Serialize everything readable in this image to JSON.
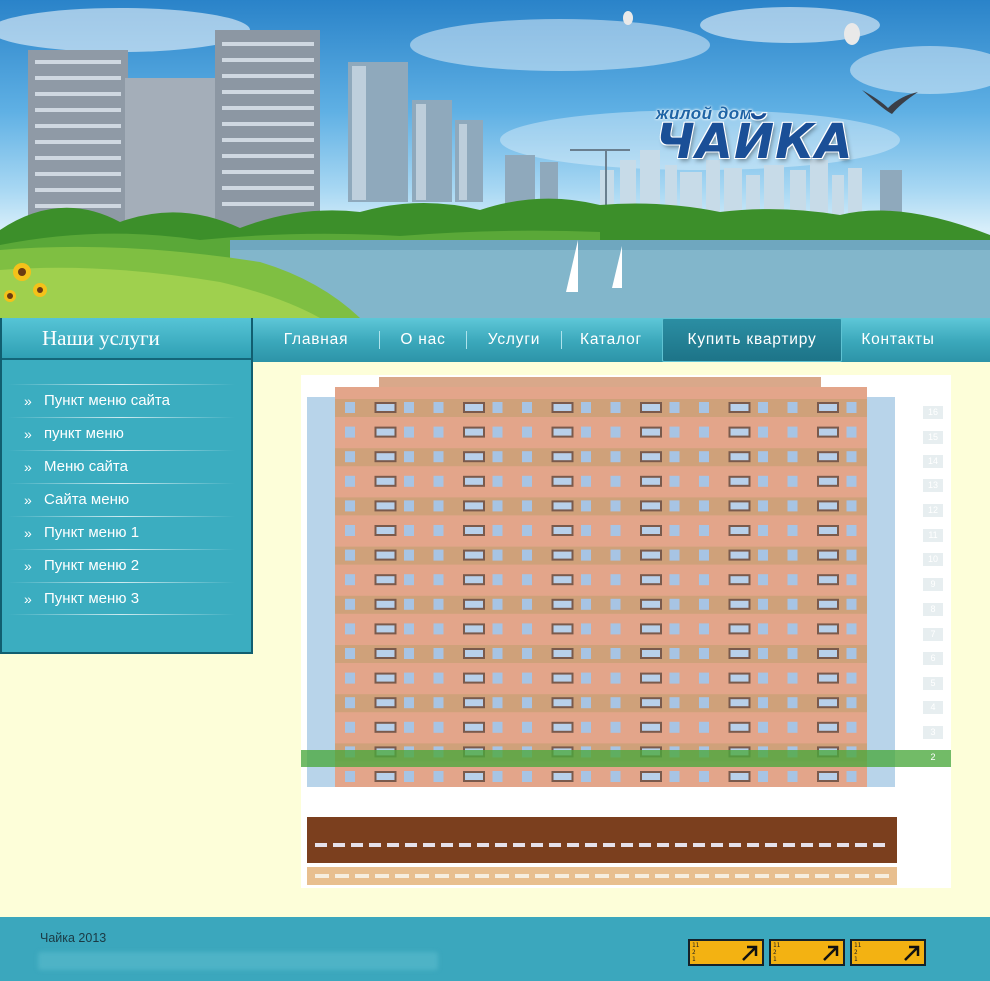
{
  "banner": {
    "logo_sub": "жилой дом",
    "logo_main": "ЧАЙКА"
  },
  "sidebar": {
    "title": "Наши услуги",
    "bullet": "»",
    "items": [
      {
        "label": "Пункт меню сайта"
      },
      {
        "label": "пункт меню"
      },
      {
        "label": "Меню сайта"
      },
      {
        "label": "Сайта меню"
      },
      {
        "label": "Пункт меню 1"
      },
      {
        "label": "Пункт меню 2"
      },
      {
        "label": "Пункт меню 3"
      }
    ]
  },
  "nav": {
    "items": [
      {
        "label": "Главная"
      },
      {
        "label": "О нас"
      },
      {
        "label": "Услуги"
      },
      {
        "label": "Каталог"
      },
      {
        "label": "Купить квартиру",
        "active": true
      },
      {
        "label": "Контакты"
      }
    ]
  },
  "building": {
    "floors": [
      "16",
      "15",
      "14",
      "13",
      "12",
      "11",
      "10",
      "9",
      "8",
      "7",
      "6",
      "5",
      "4",
      "3",
      "2"
    ],
    "highlighted_floor": "2"
  },
  "footer": {
    "copyright": "Чайка 2013",
    "counters": [
      {
        "line1": "11",
        "line2": "2",
        "line3": "1"
      },
      {
        "line1": "11",
        "line2": "2",
        "line3": "1"
      },
      {
        "line1": "11",
        "line2": "2",
        "line3": "1"
      }
    ]
  },
  "colors": {
    "page_bg": "#fdfed9",
    "accent": "#3badc0",
    "highlight": "#4aa83c",
    "counter": "#f3b212"
  }
}
